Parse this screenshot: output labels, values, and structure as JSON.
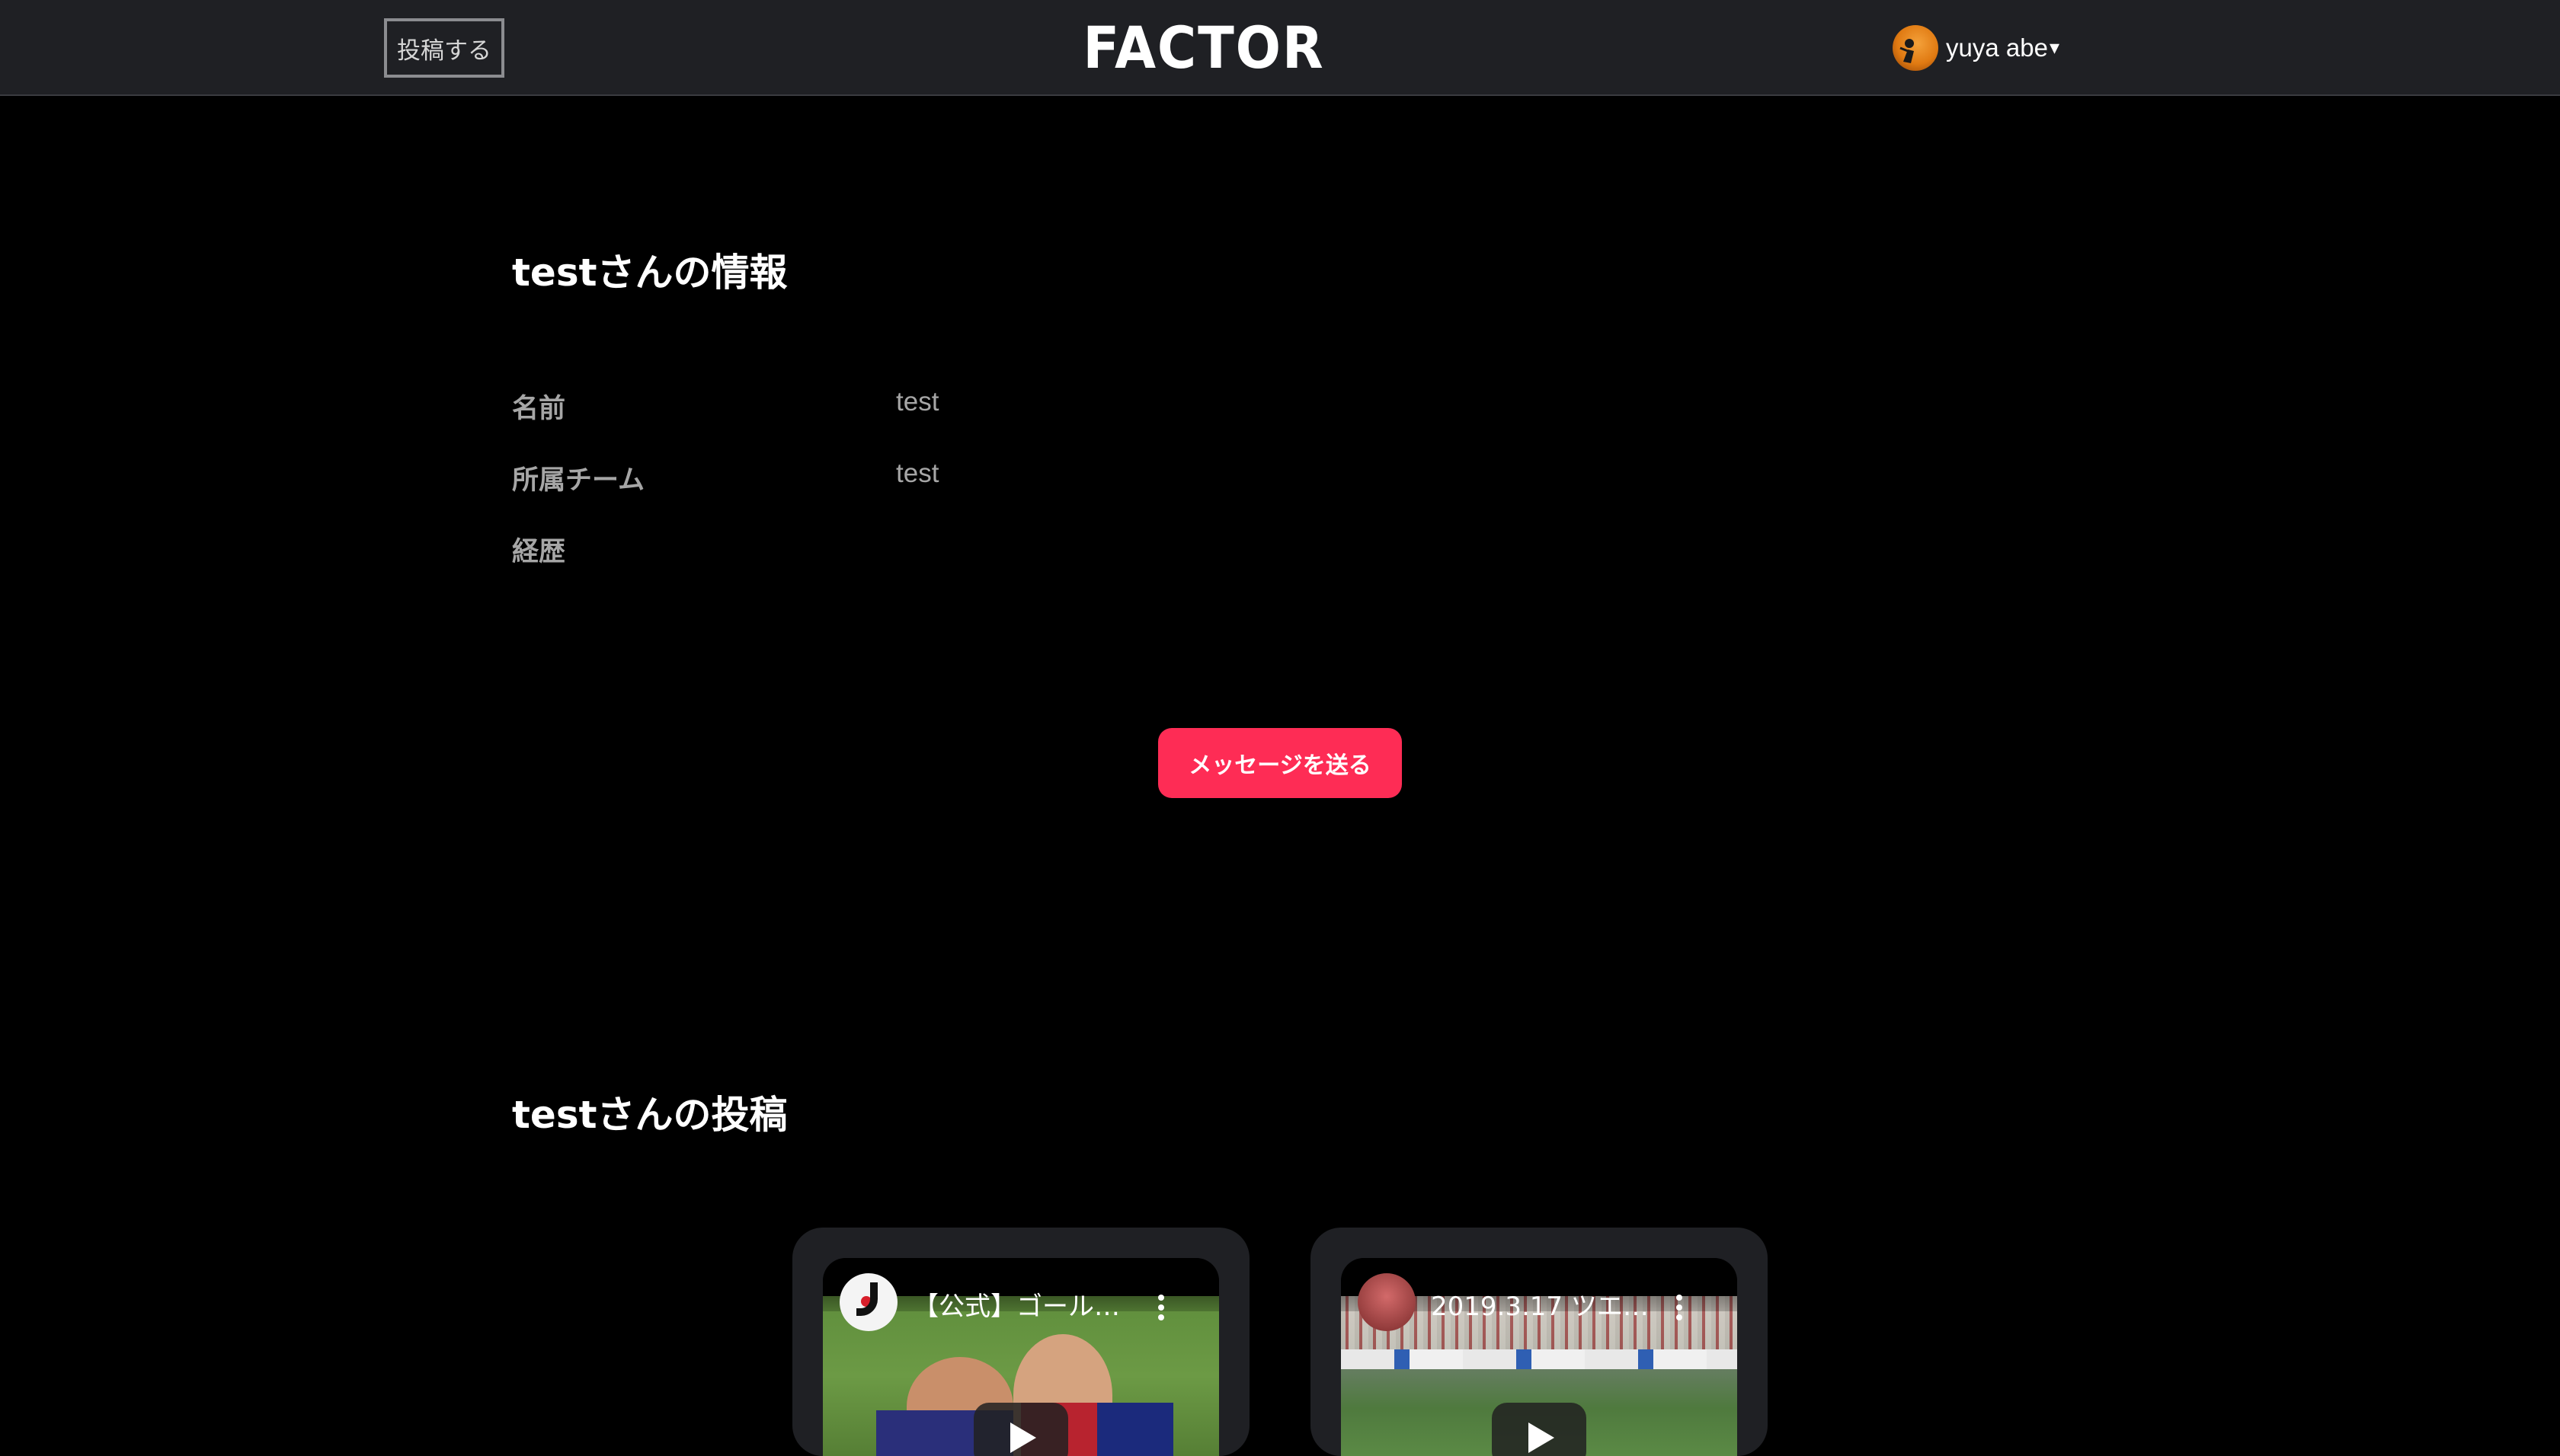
{
  "header": {
    "post_button": "投稿する",
    "logo": "FACTOR",
    "user_name": "yuya abe",
    "caret": "▾"
  },
  "profile": {
    "title": "testさんの情報",
    "rows": [
      {
        "label": "名前",
        "value": "test"
      },
      {
        "label": "所属チーム",
        "value": "test"
      },
      {
        "label": "経歴",
        "value": ""
      }
    ],
    "message_button": "メッセージを送る"
  },
  "posts": {
    "title": "testさんの投稿",
    "items": [
      {
        "video_title": "【公式】ゴール…",
        "channel_icon": "j-league-logo-icon"
      },
      {
        "video_title": "2019.3.17 ツエ…",
        "channel_icon": "channel-avatar-icon"
      }
    ]
  },
  "colors": {
    "header_bg": "#1f2024",
    "page_bg": "#000000",
    "accent": "#fe2c55",
    "label_text": "#a6a6a6"
  }
}
